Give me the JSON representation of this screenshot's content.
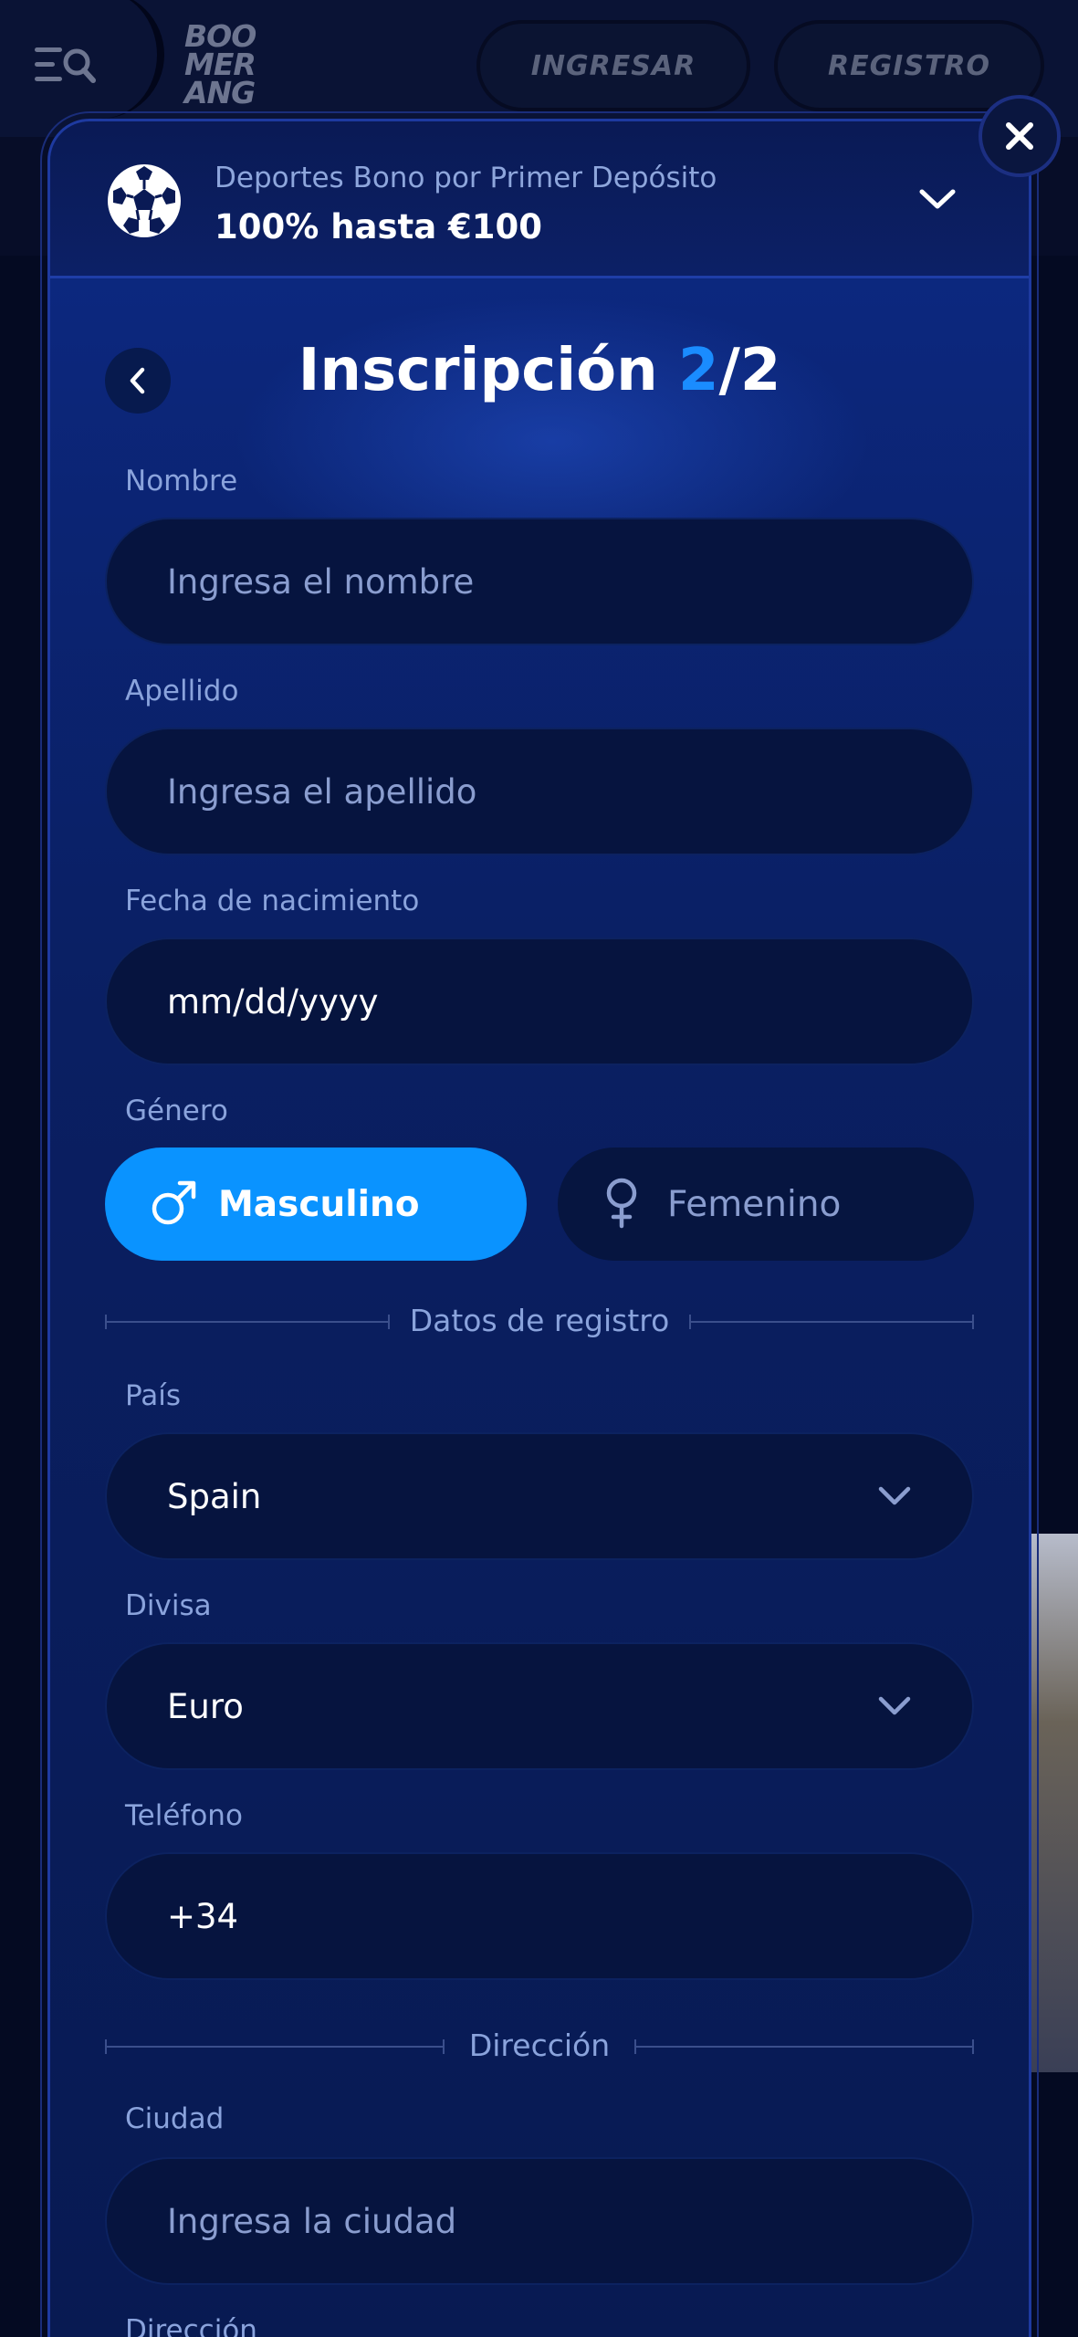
{
  "header": {
    "logo_lines": [
      "BOO",
      "MER",
      "ANG"
    ],
    "login_label": "INGRESAR",
    "register_label": "REGISTRO"
  },
  "bonus": {
    "subtitle": "Deportes Bono por Primer Depósito",
    "title": "100% hasta €100"
  },
  "form": {
    "title": "Inscripción ",
    "step_current": "2",
    "step_total": "/2",
    "first_name": {
      "label": "Nombre",
      "placeholder": "Ingresa el nombre"
    },
    "last_name": {
      "label": "Apellido",
      "placeholder": "Ingresa el apellido"
    },
    "birth_date": {
      "label": "Fecha de nacimiento",
      "value": "mm/dd/yyyy"
    },
    "gender": {
      "label": "Género",
      "male": "Masculino",
      "female": "Femenino",
      "selected": "Masculino"
    },
    "registration_divider": "Datos de registro",
    "country": {
      "label": "País",
      "value": "Spain"
    },
    "currency": {
      "label": "Divisa",
      "value": "Euro"
    },
    "phone": {
      "label": "Teléfono",
      "value": "+34"
    },
    "address_divider": "Dirección",
    "city": {
      "label": "Ciudad",
      "placeholder": "Ingresa la ciudad"
    },
    "address": {
      "label": "Dirección"
    }
  },
  "colors": {
    "accent": "#1a8cff",
    "selected_button": "#0a93ff",
    "modal_bg": "#0b2473",
    "field_bg": "#06143f"
  },
  "icons": {
    "menu": "menu-search-icon",
    "sport": "soccer-ball-icon",
    "expand": "chevron-down-icon",
    "close": "close-icon",
    "back": "chevron-left-icon",
    "male": "male-symbol-icon",
    "female": "female-symbol-icon"
  }
}
